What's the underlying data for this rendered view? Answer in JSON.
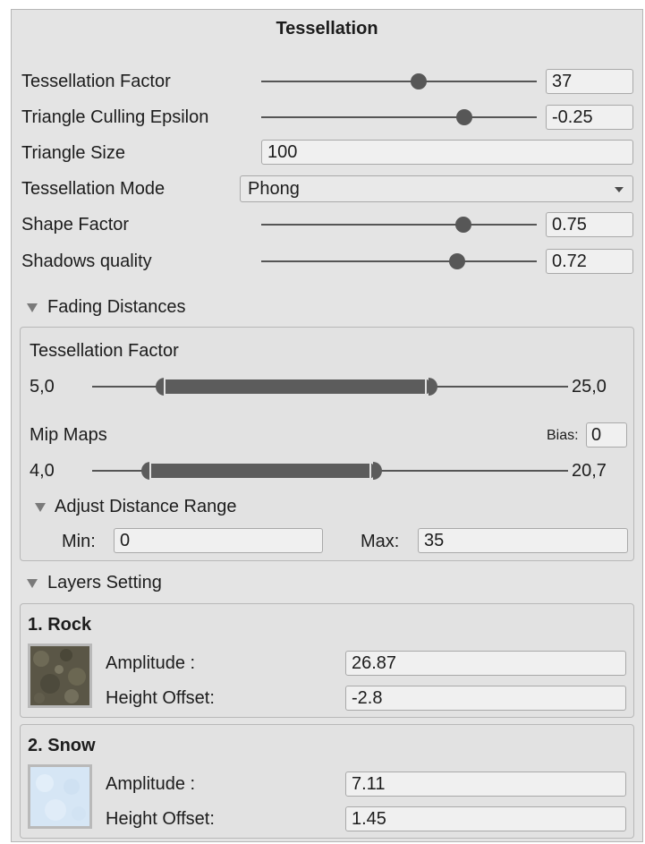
{
  "title": "Tessellation",
  "properties": {
    "tess_factor": {
      "label": "Tessellation Factor",
      "value": "37",
      "level": 0.55
    },
    "culling": {
      "label": "Triangle Culling Epsilon",
      "value": "-0.25",
      "level": 0.73
    },
    "tri_size": {
      "label": "Triangle Size",
      "value": "100"
    },
    "mode": {
      "label": "Tessellation Mode",
      "value": "Phong"
    },
    "shape": {
      "label": "Shape Factor",
      "value": "0.75",
      "level": 0.75
    },
    "shadows": {
      "label": "Shadows quality",
      "value": "0.72",
      "level": 0.72
    }
  },
  "fading": {
    "header": "Fading Distances",
    "tess": {
      "label": "Tessellation Factor",
      "min": "5,0",
      "max": "25,0"
    },
    "mip": {
      "label": "Mip Maps",
      "bias_label": "Bias:",
      "bias_value": "0",
      "min": "4,0",
      "max": "20,7"
    },
    "adjust": {
      "header": "Adjust Distance Range",
      "min_label": "Min:",
      "min_value": "0",
      "max_label": "Max:",
      "max_value": "35"
    }
  },
  "layers": {
    "header": "Layers Setting",
    "items": [
      {
        "name": "1. Rock",
        "amp_label": "Amplitude :",
        "amp_value": "26.87",
        "offset_label": "Height Offset:",
        "offset_value": "-2.8",
        "swatch": "#5e5a48"
      },
      {
        "name": "2. Snow",
        "amp_label": "Amplitude :",
        "amp_value": "7.11",
        "offset_label": "Height Offset:",
        "offset_value": "1.45",
        "swatch": "#dbe9f6"
      }
    ]
  }
}
